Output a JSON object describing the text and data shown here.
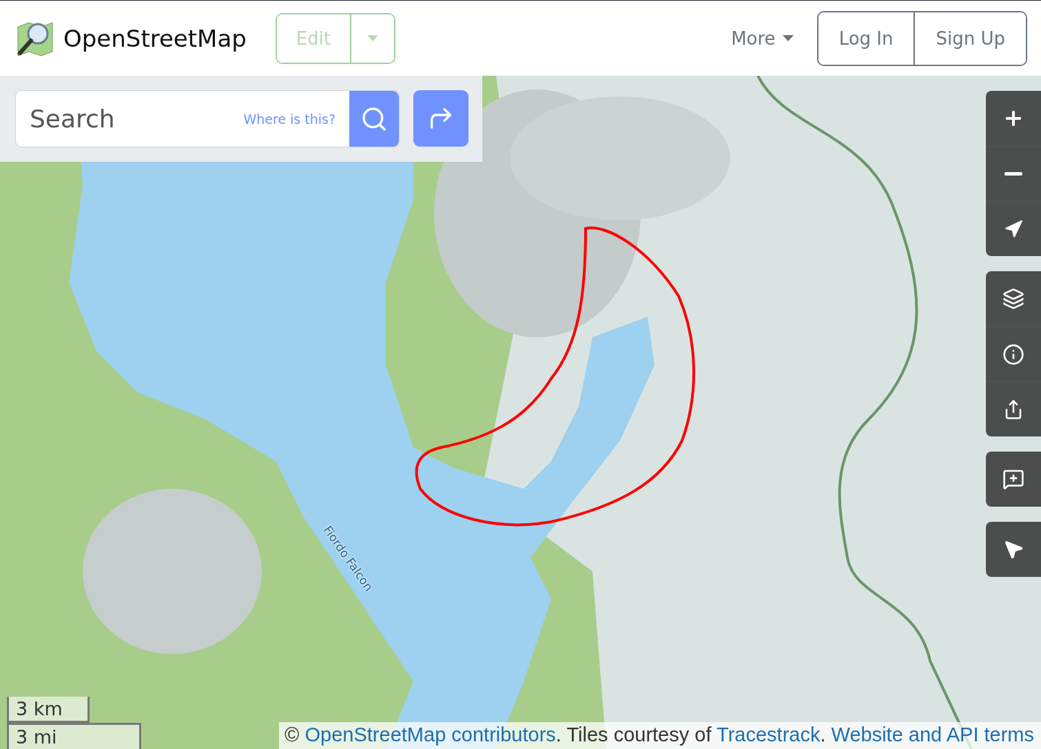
{
  "header": {
    "site_name": "OpenStreetMap",
    "edit_button": {
      "label": "Edit",
      "disabled": true
    },
    "more_menu": {
      "label": "More"
    },
    "auth_buttons": [
      "Log In",
      "Sign Up"
    ]
  },
  "search": {
    "placeholder": "Search",
    "where_link": "Where is this?"
  },
  "map": {
    "label": "Fiordo Falcon"
  },
  "scale": [
    "3 km",
    "3 mi"
  ],
  "attribution": [
    {
      "kind": "plain",
      "text": "© "
    },
    {
      "kind": "link",
      "text": "OpenStreetMap contributors"
    },
    {
      "kind": "plain",
      "text": ". Tiles courtesy of "
    },
    {
      "kind": "link",
      "text": "Tracestrack"
    },
    {
      "kind": "plain",
      "text": ". "
    },
    {
      "kind": "link",
      "text": "Website and API terms"
    }
  ]
}
